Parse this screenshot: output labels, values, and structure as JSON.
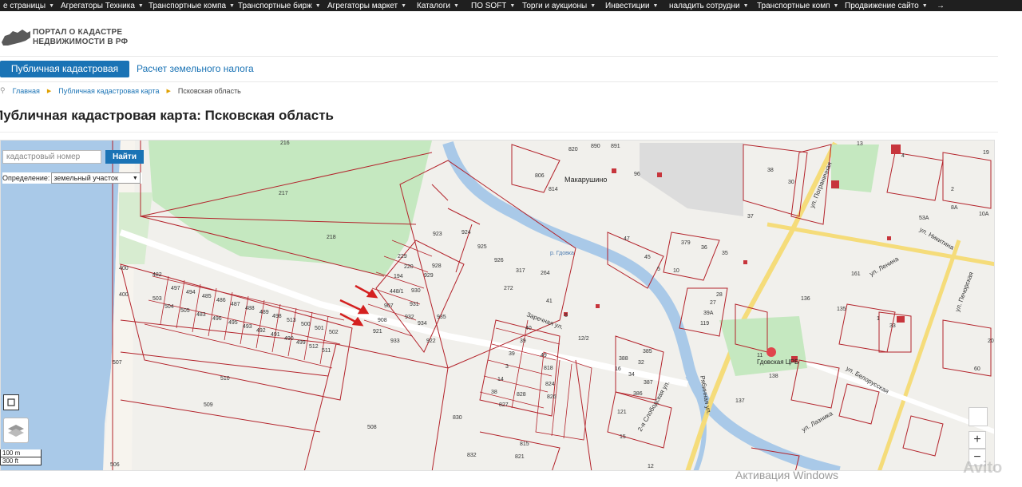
{
  "topnav": {
    "items": [
      "е страницы",
      "Агрегаторы Техника",
      "Транспортные компа",
      "Транспортные бирж",
      "Агрегаторы маркет",
      "Каталоги",
      "ПО SOFT",
      "Торги и аукционы",
      "Инвестиции",
      "наладить сотрудни",
      "Транспортные комп",
      "Продвижение сайто"
    ]
  },
  "brand": {
    "line1": "ПОРТАЛ О КАДАСТРЕ",
    "line2": "НЕДВИЖИМОСТИ В РФ"
  },
  "tabs": {
    "active": "Публичная кадастровая карта",
    "second": "Расчет земельного налога"
  },
  "breadcrumb": {
    "home": "Главная",
    "map": "Публичная кадастровая карта",
    "current": "Псковская область"
  },
  "page_title": "Публичная кадастровая карта: Псковская область",
  "search": {
    "placeholder": "кадастровый номер",
    "button": "Найти"
  },
  "definition": {
    "label": "Определение:",
    "value": "земельный участок"
  },
  "scale": {
    "metric": "100 m",
    "imperial": "300 ft"
  },
  "zoom": {
    "in": "+",
    "out": "−"
  },
  "watermark": "Активация Windows",
  "map_labels": {
    "village": "Макарушино",
    "river": "р. Гдовка",
    "hospital": "Гдовская ЦРБ",
    "streets": [
      "ул. Ленина",
      "ул. Никитина",
      "ул. Пограничная",
      "ул. Печорская",
      "ул. Лазника",
      "ул. Белорусская",
      "2-я Слободская ул.",
      "Рябинная ул.",
      "Заречная ул."
    ],
    "parcels": [
      "216",
      "217",
      "218",
      "400",
      "400",
      "482",
      "497",
      "494",
      "485",
      "486",
      "487",
      "488",
      "489",
      "498",
      "513",
      "500",
      "501",
      "502",
      "503",
      "504",
      "505",
      "483",
      "496",
      "495",
      "493",
      "492",
      "491",
      "490",
      "499",
      "512",
      "511",
      "510",
      "509",
      "508",
      "507",
      "506",
      "229",
      "220",
      "194",
      "448/1",
      "907",
      "908",
      "921",
      "928",
      "929",
      "930",
      "931",
      "932",
      "933",
      "934",
      "935",
      "922",
      "923",
      "924",
      "925",
      "926",
      "317",
      "272",
      "264",
      "41",
      "8",
      "12/2",
      "40",
      "39",
      "39",
      "3",
      "14",
      "38",
      "49",
      "818",
      "824",
      "826",
      "827",
      "828",
      "830",
      "832",
      "815",
      "821",
      "820",
      "890",
      "891",
      "806",
      "814",
      "96",
      "45",
      "47",
      "5",
      "10",
      "379",
      "36",
      "35",
      "37",
      "38",
      "30",
      "28",
      "27",
      "39A",
      "119",
      "121",
      "385",
      "386",
      "387",
      "388",
      "16",
      "34",
      "32",
      "11",
      "138",
      "137",
      "136",
      "135",
      "33",
      "20",
      "60",
      "161",
      "1",
      "15",
      "12",
      "19",
      "13",
      "4",
      "2",
      "8A",
      "10A",
      "53A",
      "29",
      "66",
      "24",
      "25",
      "27",
      "231"
    ]
  }
}
